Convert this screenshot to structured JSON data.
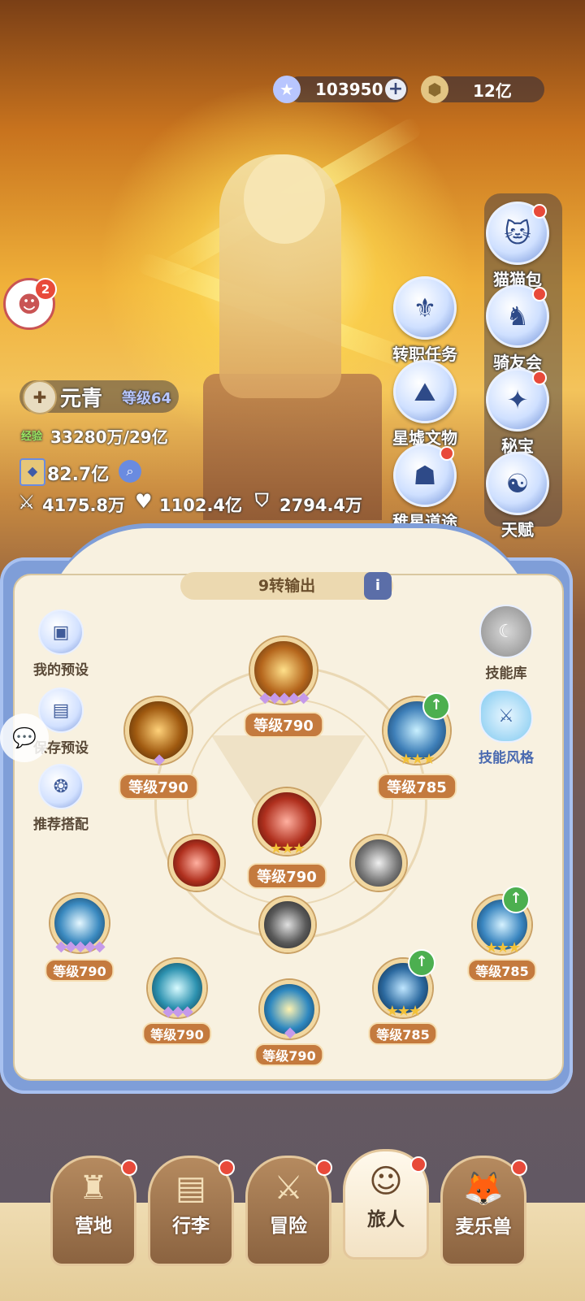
{
  "top_resources": {
    "star_value": "103950",
    "gold_value": "12亿"
  },
  "side_menu_right": [
    {
      "label": "猫猫包",
      "icon": "cat-bag-icon",
      "badge": true
    },
    {
      "label": "骑友会",
      "icon": "horse-icon",
      "badge": true
    },
    {
      "label": "秘宝",
      "icon": "treasure-icon",
      "badge": true
    },
    {
      "label": "天赋",
      "icon": "brain-icon",
      "badge": false
    }
  ],
  "side_menu_mid": [
    {
      "label": "转职任务",
      "icon": "job-change-icon",
      "badge": false
    },
    {
      "label": "星墟文物",
      "icon": "mountain-icon",
      "badge": false
    },
    {
      "label": "稚星道途",
      "icon": "hood-icon",
      "badge": true
    }
  ],
  "pet": {
    "badge": "2"
  },
  "player": {
    "name": "元青",
    "level_label": "等级64",
    "exp_label": "经验",
    "exp_value": "33280万/29亿",
    "power": "82.7亿",
    "attack": "4175.8万",
    "hp": "1102.4亿",
    "defense": "2794.4万"
  },
  "skill_panel": {
    "title": "9转输出",
    "left_buttons": [
      {
        "label": "我的预设",
        "icon": "preset-icon"
      },
      {
        "label": "保存预设",
        "icon": "save-icon"
      },
      {
        "label": "推荐搭配",
        "icon": "recommend-icon"
      }
    ],
    "right_buttons": [
      {
        "label": "技能库",
        "icon": "skill-library-icon"
      },
      {
        "label": "技能风格",
        "icon": "skill-style-icon"
      }
    ],
    "skills": [
      {
        "level": "等级790",
        "stars": "◆◆◆◆◆",
        "theme": "hourglass-gold"
      },
      {
        "level": "等级790",
        "stars": "◆",
        "theme": "swirl-gold"
      },
      {
        "level": "等级785",
        "stars": "★★★",
        "theme": "guardian-blue",
        "upgrade": true
      },
      {
        "level": "等级790",
        "stars": "★★★",
        "theme": "gear-red"
      },
      {
        "level": "",
        "stars": "",
        "theme": "gear-red-small"
      },
      {
        "level": "",
        "stars": "",
        "theme": "clock-gray"
      },
      {
        "level": "",
        "stars": "",
        "theme": "hourglass-gray"
      },
      {
        "level": "等级790",
        "stars": "◆◆◆◆◆",
        "theme": "clock-blue"
      },
      {
        "level": "等级790",
        "stars": "◆◆◆",
        "theme": "spiral-blue"
      },
      {
        "level": "等级790",
        "stars": "◆",
        "theme": "wave-blue"
      },
      {
        "level": "等级785",
        "stars": "★★★",
        "theme": "figure-blue",
        "upgrade": true
      },
      {
        "level": "等级785",
        "stars": "★★★",
        "theme": "eye-blue",
        "upgrade": true
      }
    ]
  },
  "bottom_nav": [
    {
      "label": "营地",
      "icon": "castle-icon",
      "badge": true,
      "active": false
    },
    {
      "label": "行李",
      "icon": "chest-icon",
      "badge": true,
      "active": false
    },
    {
      "label": "冒险",
      "icon": "crossed-swords-icon",
      "badge": true,
      "active": false
    },
    {
      "label": "旅人",
      "icon": "traveler-icon",
      "badge": true,
      "active": true
    },
    {
      "label": "麦乐兽",
      "icon": "fox-icon",
      "badge": true,
      "active": false
    }
  ],
  "colors": {
    "accent_blue": "#7f9ed8",
    "panel_bg": "#f8f1e0",
    "badge_red": "#e84a3a",
    "level_brown": "#c47a3e"
  }
}
